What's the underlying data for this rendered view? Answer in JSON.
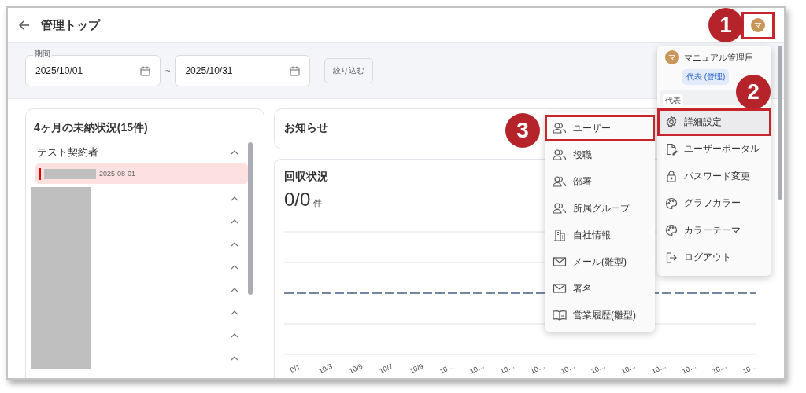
{
  "header": {
    "title": "管理トップ",
    "avatar": "マ",
    "avatar_framed": true
  },
  "filter": {
    "label": "期間",
    "start": "2025/10/01",
    "separator": "~",
    "end": "2025/10/31",
    "button": "絞り込む"
  },
  "arrears": {
    "title": "4ヶ月の未納状況(15件)",
    "groups": [
      {
        "name": "テスト契約者",
        "redacted": false,
        "expanded": true,
        "entries": [
          {
            "date": "2025-08-01",
            "highlighted": true
          }
        ]
      },
      {
        "redacted": true,
        "expanded": true
      },
      {
        "redacted": true,
        "expanded": true
      },
      {
        "redacted": true,
        "expanded": true
      },
      {
        "redacted": true,
        "expanded": true
      },
      {
        "redacted": true,
        "expanded": true
      },
      {
        "redacted": true,
        "expanded": true
      },
      {
        "redacted": true,
        "expanded": true
      },
      {
        "redacted": true,
        "expanded": true
      }
    ]
  },
  "notices": {
    "title": "お知らせ"
  },
  "collection": {
    "title": "回収状況",
    "count": "0/0",
    "unit": "件",
    "x_labels": [
      "0/1",
      "10/3",
      "10/5",
      "10/7",
      "10/9",
      "10…",
      "10…",
      "10…",
      "10…",
      "10…",
      "10…",
      "10…",
      "10…",
      "10…",
      "10…",
      "10…"
    ]
  },
  "account_menu": {
    "avatar": "マ",
    "name": "マニュアル管理用",
    "role": "代表 (管理)",
    "role_select": "代表",
    "items": [
      {
        "label": "詳細設定",
        "kind": "gear",
        "selected": true,
        "framed": true
      },
      {
        "label": "ユーザーポータル",
        "kind": "file",
        "selected": false,
        "framed": false
      },
      {
        "label": "パスワード変更",
        "kind": "lock",
        "selected": false,
        "framed": false
      },
      {
        "label": "グラフカラー",
        "kind": "palette",
        "selected": false,
        "framed": false
      },
      {
        "label": "カラーテーマ",
        "kind": "palette",
        "selected": false,
        "framed": false
      },
      {
        "label": "ログアウト",
        "kind": "logout",
        "selected": false,
        "framed": false
      }
    ]
  },
  "submenu": {
    "items": [
      {
        "label": "ユーザー",
        "kind": "users",
        "framed": true
      },
      {
        "label": "役職",
        "kind": "users",
        "framed": false
      },
      {
        "label": "部署",
        "kind": "users",
        "framed": false
      },
      {
        "label": "所属グループ",
        "kind": "users",
        "framed": false
      },
      {
        "label": "自社情報",
        "kind": "building",
        "framed": false
      },
      {
        "label": "メール(雛型)",
        "kind": "mail",
        "framed": false
      },
      {
        "label": "署名",
        "kind": "mail",
        "framed": false
      },
      {
        "label": "営業履歴(雛型)",
        "kind": "book",
        "framed": false
      }
    ]
  },
  "annotations": [
    {
      "number": "1"
    },
    {
      "number": "2"
    },
    {
      "number": "3"
    }
  ]
}
